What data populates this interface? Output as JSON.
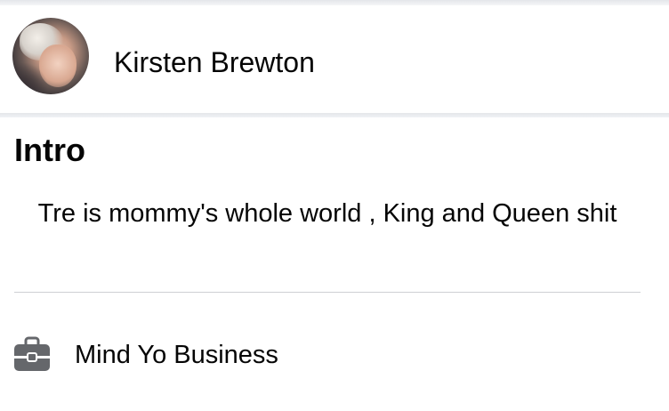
{
  "profile": {
    "name": "Kirsten Brewton",
    "avatar_icon": "profile-photo"
  },
  "intro": {
    "title": "Intro",
    "bio": "Tre is mommy's whole world , King and Queen shit",
    "work": {
      "icon": "briefcase-icon",
      "label": "Mind Yo Business"
    }
  },
  "colors": {
    "text": "#050505",
    "divider": "#ced0d4",
    "icon": "#65676b"
  }
}
